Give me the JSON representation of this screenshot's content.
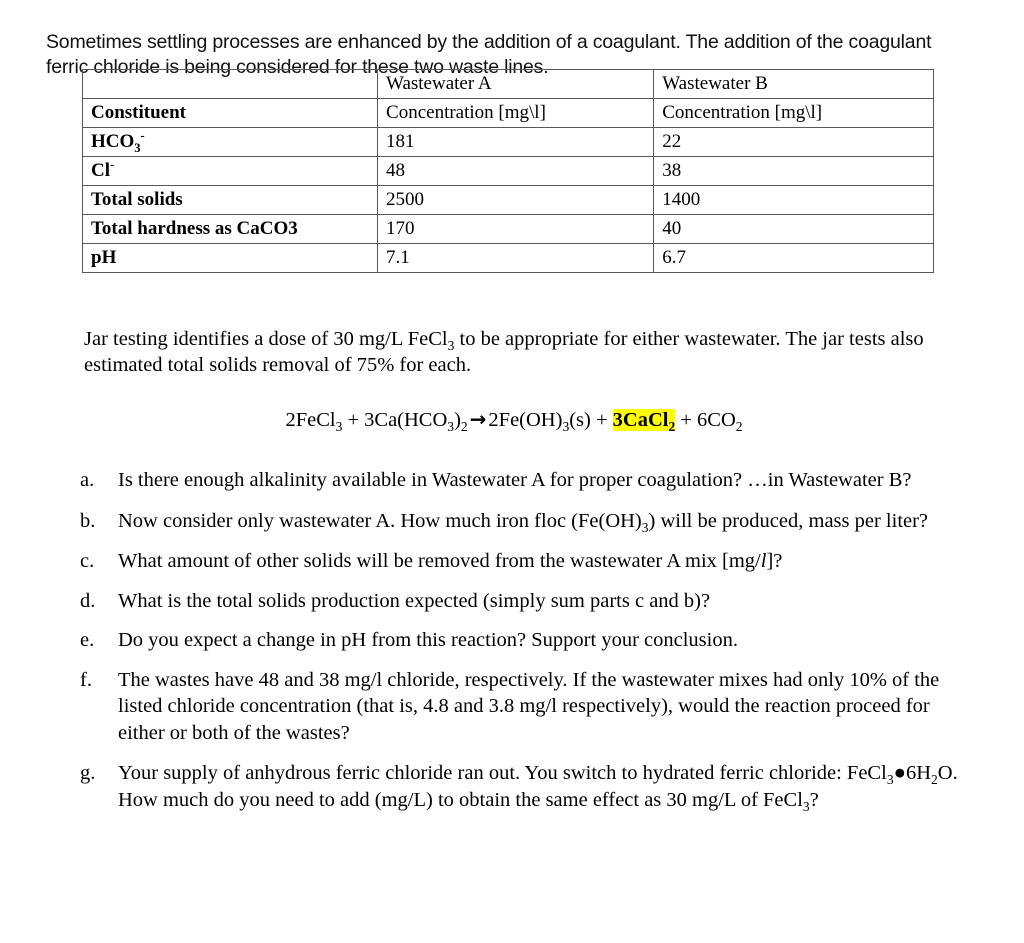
{
  "intro": {
    "text": "Sometimes settling processes are enhanced by the addition of a coagulant.  The addition of the coagulant ferric chloride is being considered for these two waste lines."
  },
  "table": {
    "header_row": [
      "",
      "Wastewater A",
      "Wastewater B"
    ],
    "subheader_row": [
      "Constituent",
      "Concentration [mg\\l]",
      "Concentration [mg\\l]"
    ],
    "rows": [
      {
        "constituent_html": "HCO<sub>3</sub><sup>-</sup>",
        "a": "181",
        "b": "22"
      },
      {
        "constituent_html": "Cl<sup>-</sup>",
        "a": "48",
        "b": "38"
      },
      {
        "constituent_html": "Total solids",
        "a": "2500",
        "b": "1400"
      },
      {
        "constituent_html": "Total hardness as CaCO3",
        "a": "170",
        "b": "40"
      },
      {
        "constituent_html": "pH",
        "a": "7.1",
        "b": "6.7"
      }
    ]
  },
  "jar_testing": {
    "line1_html": "Jar testing identifies a dose of 30 mg/L FeCl<sub>3</sub> to be appropriate for either wastewater.",
    "line2": "The jar tests also estimated total solids removal of 75% for each."
  },
  "equation": {
    "left_html": "2FeCl<sub>3</sub> + 3Ca(HCO<sub>3</sub>)<sub>2</sub>",
    "arrow": "→",
    "right_pre_html": "2Fe(OH)<sub>3</sub>(s) +",
    "highlighted_html": "3CaCl<sub>2</sub>",
    "right_post_html": "+ 6CO<sub>2</sub>",
    "highlight_color": "#ffff00"
  },
  "questions": [
    {
      "marker": "a.",
      "text_html": "Is there enough alkalinity available in Wastewater A for proper coagulation?  …in Wastewater B?"
    },
    {
      "marker": "b.",
      "text_html": "Now consider only wastewater A. How much iron floc (Fe(OH)<sub>3</sub>) will be produced, mass per liter?"
    },
    {
      "marker": "c.",
      "text_html": "What amount of other solids will be removed from the wastewater A mix [mg/<span class=\"ital\">l</span>]?"
    },
    {
      "marker": "d.",
      "text_html": "What is the total solids production expected (simply sum parts c and b)?"
    },
    {
      "marker": "e.",
      "text_html": "Do you expect a change in pH from this reaction? Support your conclusion."
    },
    {
      "marker": "f.",
      "text_html": "The wastes have 48 and 38 mg/l chloride, respectively. If the wastewater mixes had only 10% of the listed chloride concentration (that is, 4.8 and 3.8 mg/l respectively), would the reaction proceed for either or both of the wastes?"
    },
    {
      "marker": "g.",
      "text_html": "Your supply of anhydrous ferric chloride ran out.  You switch to hydrated ferric chloride:  FeCl<sub>3</sub>●6H<sub>2</sub>O.  How much do you need to add (mg/L) to obtain the same effect as 30 mg/L of FeCl<sub>3</sub>?"
    }
  ]
}
